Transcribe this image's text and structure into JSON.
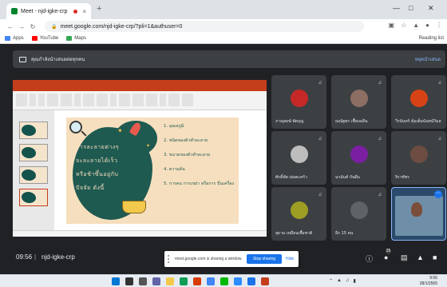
{
  "browser": {
    "tab_title": "Meet - njd-igke-crp",
    "tab_close": "×",
    "new_tab": "+",
    "url": "meet.google.com/njd-igke-crp/?pli=1&authuser=0",
    "bookmarks": [
      {
        "label": "Apps",
        "color": "#4285f4"
      },
      {
        "label": "YouTube",
        "color": "#ff0000"
      },
      {
        "label": "Maps",
        "color": "#34a853"
      }
    ],
    "reading_list": "Reading list"
  },
  "banner": {
    "text": "คุณกำลังนำเสนอต่อทุกคน",
    "stop": "หยุดนำเสนอ"
  },
  "slide": {
    "title_lines": [
      "สารละลายต่างๆ",
      "จะละลายได้เร็ว",
      "หรือช้าขึ้นอยู่กับ",
      "ปัจจัย ดังนี้"
    ],
    "list": [
      "1. อุณหภูมิ",
      "2. ชนิดของตัวทำละลาย",
      "3. ขนาดของตัวทำละลาย",
      "4. ความดัน",
      "5. การคน การเขย่า หรือการ ปั่นเครื่อง"
    ]
  },
  "participants": [
    {
      "name": "ภาณุพงษ์ พัดบุญ",
      "avatar_color": "#c62828"
    },
    {
      "name": "ณณัฐพร เชื้อบอลีน",
      "avatar_color": "#8d6e63"
    },
    {
      "name": "วีรนันทร์ คุ้มเต็มนันทน์วิมล",
      "avatar_color": "#d84315"
    },
    {
      "name": "ศักดิ์พัส เย่อตะครัว",
      "avatar_color": "#bdbdbd"
    },
    {
      "name": "นวนันท์ กันดีม",
      "avatar_color": "#7b1fa2"
    },
    {
      "name": "จิราพัชร",
      "avatar_color": "#6d4c41"
    },
    {
      "name": "สุธาม เหมือนเชื้อชาติ",
      "avatar_color": "#9e9d24"
    },
    {
      "name": "อีก 15 คน",
      "avatar_color": "#5f6368"
    },
    {
      "name": "",
      "avatar_color": "#7a4e3a"
    }
  ],
  "bottombar": {
    "time": "09:56",
    "separator": "|",
    "code": "njd-igke-crp",
    "people_count": "25"
  },
  "share_bar": {
    "text": "meet.google.com is sharing a window.",
    "stop": "Stop sharing",
    "hide": "Hide"
  },
  "taskbar": {
    "time": "9:56",
    "date": "28/1/2565"
  }
}
